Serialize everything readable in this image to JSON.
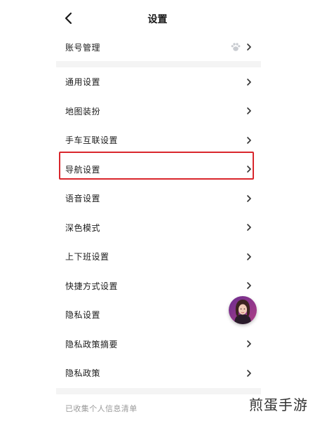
{
  "header": {
    "title": "设置",
    "back_icon": "chevron-left-icon"
  },
  "account": {
    "label": "账号管理",
    "badge_icon": "paw-icon"
  },
  "settings_items": [
    {
      "label": "通用设置"
    },
    {
      "label": "地图装扮"
    },
    {
      "label": "手车互联设置"
    },
    {
      "label": "导航设置",
      "highlighted": true
    },
    {
      "label": "语音设置"
    },
    {
      "label": "深色模式"
    },
    {
      "label": "上下班设置"
    },
    {
      "label": "快捷方式设置"
    },
    {
      "label": "隐私设置"
    },
    {
      "label": "隐私政策摘要"
    },
    {
      "label": "隐私政策"
    }
  ],
  "footer": {
    "label": "已收集个人信息清单"
  },
  "floating_avatar": {
    "icon": "assistant-avatar"
  },
  "watermark": {
    "text": "煎蛋手游"
  },
  "colors": {
    "highlight_border": "#d9262c",
    "divider": "#f4f4f4",
    "footer_text": "#9a9a9a"
  }
}
